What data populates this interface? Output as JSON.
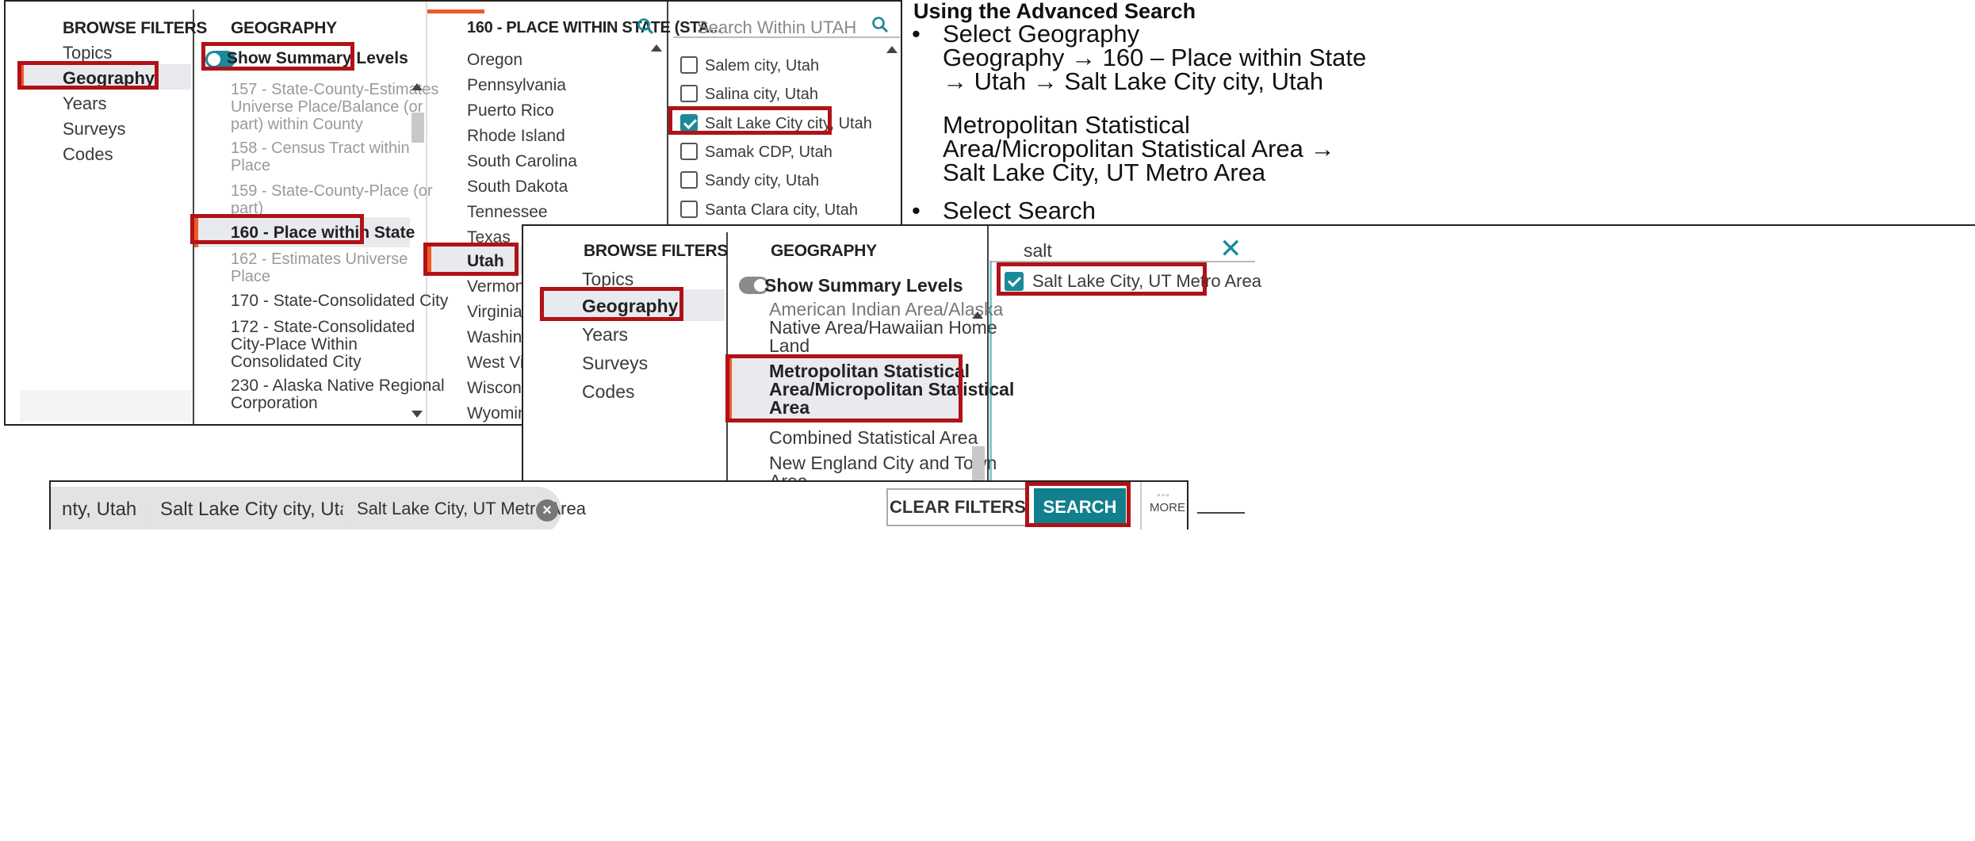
{
  "panel1": {
    "col1": {
      "header": "BROWSE FILTERS",
      "items": [
        "Topics",
        "Geography",
        "Years",
        "Surveys",
        "Codes"
      ]
    },
    "col2": {
      "header": "GEOGRAPHY",
      "toggle_label": "Show Summary Levels",
      "items": [
        [
          "157 - State-County-Estimates",
          "Universe Place/Balance (or",
          "part) within County"
        ],
        [
          "158 - Census Tract within",
          "Place"
        ],
        [
          "159 - State-County-Place (or",
          "part)"
        ],
        [
          "160 - Place within State"
        ],
        [
          "162 - Estimates Universe",
          "Place"
        ],
        [
          "170 - State-Consolidated City"
        ],
        [
          "172 - State-Consolidated",
          "City-Place Within",
          "Consolidated City"
        ],
        [
          "230 - Alaska Native Regional",
          "Corporation"
        ]
      ]
    },
    "col3": {
      "header": "160 - PLACE WITHIN STATE (STA...",
      "items": [
        "Oregon",
        "Pennsylvania",
        "Puerto Rico",
        "Rhode Island",
        "South Carolina",
        "South Dakota",
        "Tennessee",
        "Texas",
        "Utah",
        "Vermont",
        "Virginia",
        "Washingto",
        "West Virgi",
        "Wisconsin",
        "Wyoming"
      ]
    },
    "col4": {
      "search_placeholder": "Search Within UTAH",
      "items": [
        {
          "label": "Salem city, Utah",
          "checked": false
        },
        {
          "label": "Salina city, Utah",
          "checked": false
        },
        {
          "label": "Salt Lake City city, Utah",
          "checked": true
        },
        {
          "label": "Samak CDP, Utah",
          "checked": false
        },
        {
          "label": "Sandy city, Utah",
          "checked": false
        },
        {
          "label": "Santa Clara city, Utah",
          "checked": false
        }
      ]
    }
  },
  "instructions": {
    "title": "Using the Advanced Search",
    "bullet1": "Select Geography",
    "line1": "Geography → 160 – Place within State",
    "line2": "→ Utah → Salt Lake City city, Utah",
    "line3": "Metropolitan Statistical",
    "line4": "Area/Micropolitan Statistical Area →",
    "line5": "Salt Lake City, UT Metro Area",
    "bullet2": "Select Search"
  },
  "panel2": {
    "col1": {
      "header": "BROWSE FILTERS",
      "items": [
        "Topics",
        "Geography",
        "Years",
        "Surveys",
        "Codes"
      ]
    },
    "col2": {
      "header": "GEOGRAPHY",
      "toggle_label": "Show Summary Levels",
      "items": [
        [
          "American Indian Area/Alaska",
          "Native Area/Hawaiian Home",
          "Land"
        ],
        [
          "Metropolitan Statistical",
          "Area/Micropolitan Statistical",
          "Area"
        ],
        [
          "Combined Statistical Area"
        ],
        [
          "New England City and Town",
          "Area"
        ]
      ]
    },
    "col3": {
      "search_value": "salt",
      "items": [
        {
          "label": "Salt Lake City, UT Metro Area",
          "checked": true
        }
      ]
    }
  },
  "chips_bar": {
    "chips": [
      "nty, Utah",
      "Salt Lake City city, Utah",
      "Salt Lake City, UT Metro Area"
    ],
    "clear_label": "CLEAR FILTERS",
    "search_label": "SEARCH",
    "more_label": "MORE"
  },
  "colors": {
    "accent": "#ef5a28",
    "highlight": "#b01218",
    "teal": "#1a8a9a"
  }
}
